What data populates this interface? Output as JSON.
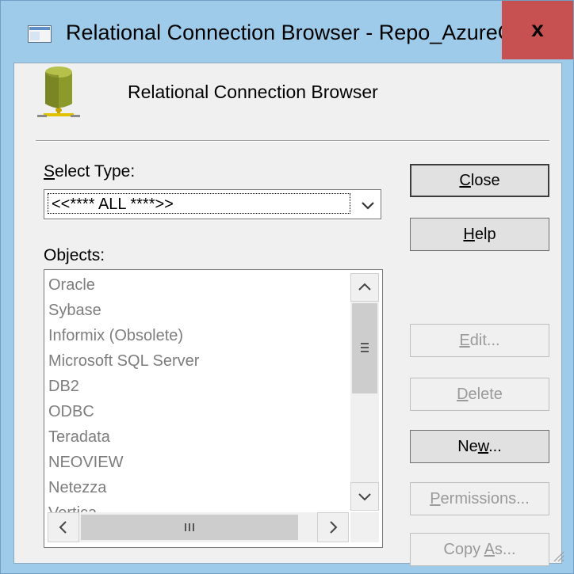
{
  "window": {
    "title": "Relational Connection Browser - Repo_AzureODBC",
    "close_glyph": "x"
  },
  "header": {
    "title": "Relational Connection Browser",
    "icon": "database-icon"
  },
  "select_type": {
    "label_mnemonic": "S",
    "label_rest": "elect Type:",
    "value": "<<**** ALL ****>>"
  },
  "objects": {
    "label_pre": "Ob",
    "label_mnemonic": "j",
    "label_rest": "ects:",
    "items": [
      "Oracle",
      "Sybase",
      "Informix (Obsolete)",
      "Microsoft SQL Server",
      "DB2",
      "ODBC",
      "Teradata",
      "NEOVIEW",
      "Netezza",
      "Vertica"
    ]
  },
  "buttons": {
    "close": {
      "mnemonic": "C",
      "rest": "lose"
    },
    "help": {
      "mnemonic": "H",
      "rest": "elp"
    },
    "edit": {
      "mnemonic": "E",
      "rest": "dit..."
    },
    "delete": {
      "mnemonic": "D",
      "rest": "elete"
    },
    "new": {
      "pre": "Ne",
      "mnemonic": "w",
      "rest": "..."
    },
    "permissions": {
      "mnemonic": "P",
      "rest": "ermissions..."
    },
    "copy_as": {
      "pre": "Copy ",
      "mnemonic": "A",
      "rest": "s..."
    }
  },
  "colors": {
    "title_bar": "#9ecbe9",
    "close_button": "#c75050",
    "client_bg": "#f0f0f0",
    "disabled_text": "#9a9a9a"
  }
}
